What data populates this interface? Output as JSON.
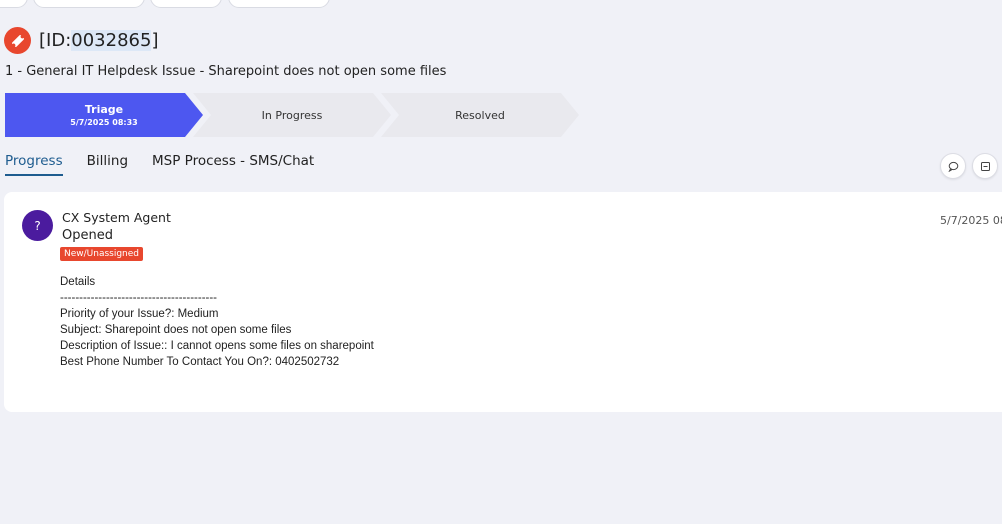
{
  "ticket": {
    "id_prefix": "[ID:",
    "id_number": "0032865",
    "id_suffix": "]",
    "subject": "1 - General IT Helpdesk Issue - Sharepoint does not open some files"
  },
  "stages": [
    {
      "title": "Triage",
      "date": "5/7/2025 08:33",
      "active": true
    },
    {
      "title": "In Progress",
      "date": "",
      "active": false
    },
    {
      "title": "Resolved",
      "date": "",
      "active": false
    }
  ],
  "tabs": [
    {
      "label": "Progress",
      "active": true
    },
    {
      "label": "Billing",
      "active": false
    },
    {
      "label": "MSP Process - SMS/Chat",
      "active": false
    }
  ],
  "tools": [
    {
      "icon": "comment-icon"
    },
    {
      "icon": "collapse-icon"
    }
  ],
  "entry": {
    "avatar_initial": "?",
    "author": "CX System Agent",
    "action": "Opened",
    "status_badge": "New/Unassigned",
    "timestamp": "5/7/2025 08:",
    "details_lines": [
      "Details",
      "-----------------------------------------",
      "Priority of your Issue?: Medium",
      "Subject: Sharepoint does not open some files",
      "Description of Issue:: I cannot opens some files on sharepoint",
      "Best Phone Number To Contact You On?: 0402502732"
    ]
  },
  "colors": {
    "accent": "#4d57f0",
    "badge": "#e8472e",
    "avatar": "#4b1b9e",
    "tab_active": "#1e5c8f",
    "background": "#f0f1f7"
  }
}
